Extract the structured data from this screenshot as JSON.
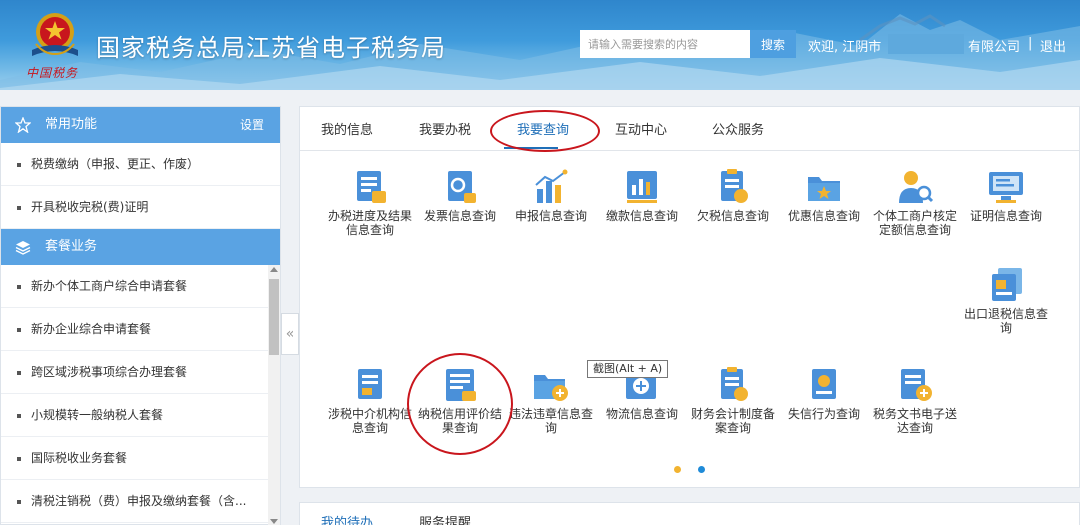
{
  "header": {
    "title": "国家税务总局江苏省电子税务局",
    "seal_text": "中国税务",
    "search_placeholder": "请输入需要搜索的内容",
    "search_button": "搜索",
    "welcome": "欢迎, 江阴市",
    "company_suffix": "有限公司",
    "separator": "|",
    "logout": "退出"
  },
  "sidebar": {
    "common_title": "常用功能",
    "common_setting": "设置",
    "common_items": [
      {
        "label": "税费缴纳（申报、更正、作废）"
      },
      {
        "label": "开具税收完税(费)证明"
      }
    ],
    "package_title": "套餐业务",
    "package_items": [
      {
        "label": "新办个体工商户综合申请套餐"
      },
      {
        "label": "新办企业综合申请套餐"
      },
      {
        "label": "跨区域涉税事项综合办理套餐"
      },
      {
        "label": "小规模转一般纳税人套餐"
      },
      {
        "label": "国际税收业务套餐"
      },
      {
        "label": "清税注销税（费）申报及缴纳套餐（含..."
      }
    ],
    "collapse_glyph": "«"
  },
  "main": {
    "tabs": [
      {
        "label": "我的信息"
      },
      {
        "label": "我要办税"
      },
      {
        "label": "我要查询"
      },
      {
        "label": "互动中心"
      },
      {
        "label": "公众服务"
      }
    ],
    "active_tab": "我要查询",
    "row1": [
      {
        "label": "办税进度及结果信息查询",
        "icon": "document-list-icon"
      },
      {
        "label": "发票信息查询",
        "icon": "invoice-search-icon"
      },
      {
        "label": "申报信息查询",
        "icon": "bar-chart-icon"
      },
      {
        "label": "缴款信息查询",
        "icon": "payment-chart-icon"
      },
      {
        "label": "欠税信息查询",
        "icon": "arrears-document-icon"
      },
      {
        "label": "优惠信息查询",
        "icon": "discount-folder-icon"
      },
      {
        "label": "个体工商户核定定额信息查询",
        "icon": "person-search-icon"
      },
      {
        "label": "证明信息查询",
        "icon": "certificate-monitor-icon"
      }
    ],
    "export_refund": {
      "label": "出口退税信息查询",
      "icon": "export-stack-icon"
    },
    "row2": [
      {
        "label": "涉税中介机构信息查询",
        "icon": "agency-document-icon"
      },
      {
        "label": "纳税信用评价结果查询",
        "icon": "credit-report-icon"
      },
      {
        "label": "违法违章信息查询",
        "icon": "violation-folder-icon"
      },
      {
        "label": "物流信息查询",
        "icon": "logistics-box-icon"
      },
      {
        "label": "财务会计制度备案查询",
        "icon": "accounting-document-icon"
      },
      {
        "label": "失信行为查询",
        "icon": "dishonesty-badge-icon"
      },
      {
        "label": "税务文书电子送达查询",
        "icon": "tax-document-add-icon"
      }
    ],
    "tooltip": "截图(Alt + A)"
  },
  "bottom": {
    "tabs": [
      {
        "label": "我的待办"
      },
      {
        "label": "服务提醒"
      }
    ]
  },
  "colors": {
    "accent": "#5aa3e3",
    "active_tab": "#1f6fb8",
    "annotation_red": "#c9161d",
    "pager_active": "#f2b330",
    "pager_inactive": "#1f8bd8"
  }
}
